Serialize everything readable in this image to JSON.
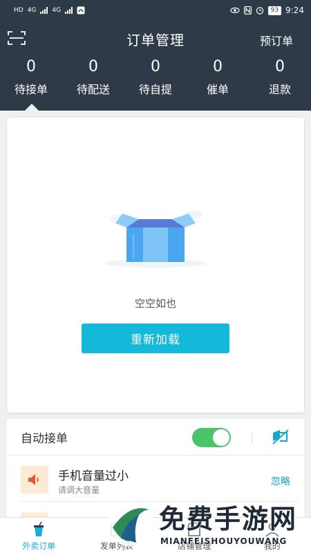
{
  "statusbar": {
    "left_tags": [
      "HD",
      "4G",
      "4G"
    ],
    "battery": "93",
    "time": "9:24"
  },
  "header": {
    "title": "订单管理",
    "preorder_label": "预订单",
    "scan_icon": "scan-icon"
  },
  "stats": [
    {
      "count": "0",
      "label": "待接单"
    },
    {
      "count": "0",
      "label": "待配送"
    },
    {
      "count": "0",
      "label": "待自提"
    },
    {
      "count": "0",
      "label": "催单"
    },
    {
      "count": "0",
      "label": "退款"
    }
  ],
  "empty": {
    "text": "空空如也",
    "reload_label": "重新加载",
    "illustration": "empty-box"
  },
  "settings": {
    "auto_accept_label": "自动接单",
    "auto_accept_on": true,
    "volume_title": "手机音量过小",
    "volume_subtitle": "请调大音量",
    "ignore_label": "忽略"
  },
  "bottom_nav": [
    {
      "label": "外卖订单",
      "icon": "takeout-cup-icon",
      "active": true
    },
    {
      "label": "发单列表",
      "icon": "list-icon",
      "active": false
    },
    {
      "label": "店铺管理",
      "icon": "store-icon",
      "active": false
    },
    {
      "label": "我的",
      "icon": "profile-icon",
      "active": false
    }
  ],
  "watermark": {
    "title": "免费手游网",
    "subtitle": "MIANFEISHOUYOUWANG"
  },
  "colors": {
    "header_bg": "#2f3a48",
    "accent": "#12b9d8",
    "toggle_on": "#4cc46b",
    "active_nav": "#16aee0"
  }
}
